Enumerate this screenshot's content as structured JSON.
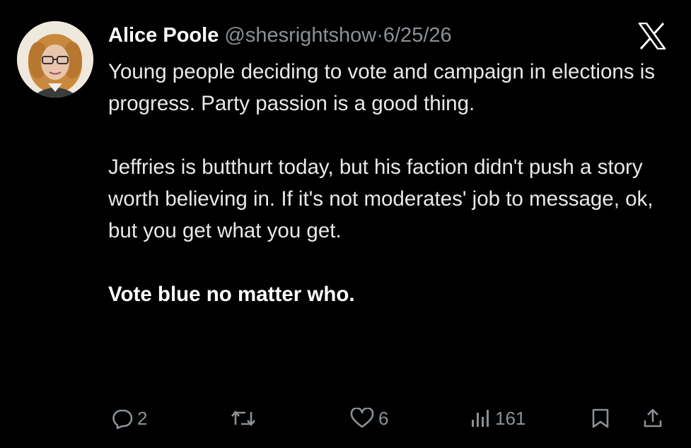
{
  "tweet": {
    "author": {
      "display_name": "Alice Poole",
      "handle": "@shesrightshow",
      "separator": "·",
      "date": "6/25/26",
      "avatar_icon": "profile-photo"
    },
    "platform_icon": "x-logo-icon",
    "text": {
      "paragraph_1": "Young people deciding to vote and campaign in elections is progress. Party passion is a good thing.",
      "paragraph_2": "Jeffries is butthurt today, but his faction didn't push a story worth believing in. If it's not moderates' job to message, ok, but you get what you get.",
      "paragraph_3": "Vote blue no matter who."
    },
    "actions": {
      "replies": "2",
      "retweets": "",
      "likes": "6",
      "views": "161"
    }
  },
  "colors": {
    "background": "#000000",
    "text": "#e7e9ea",
    "muted": "#8b9196"
  }
}
